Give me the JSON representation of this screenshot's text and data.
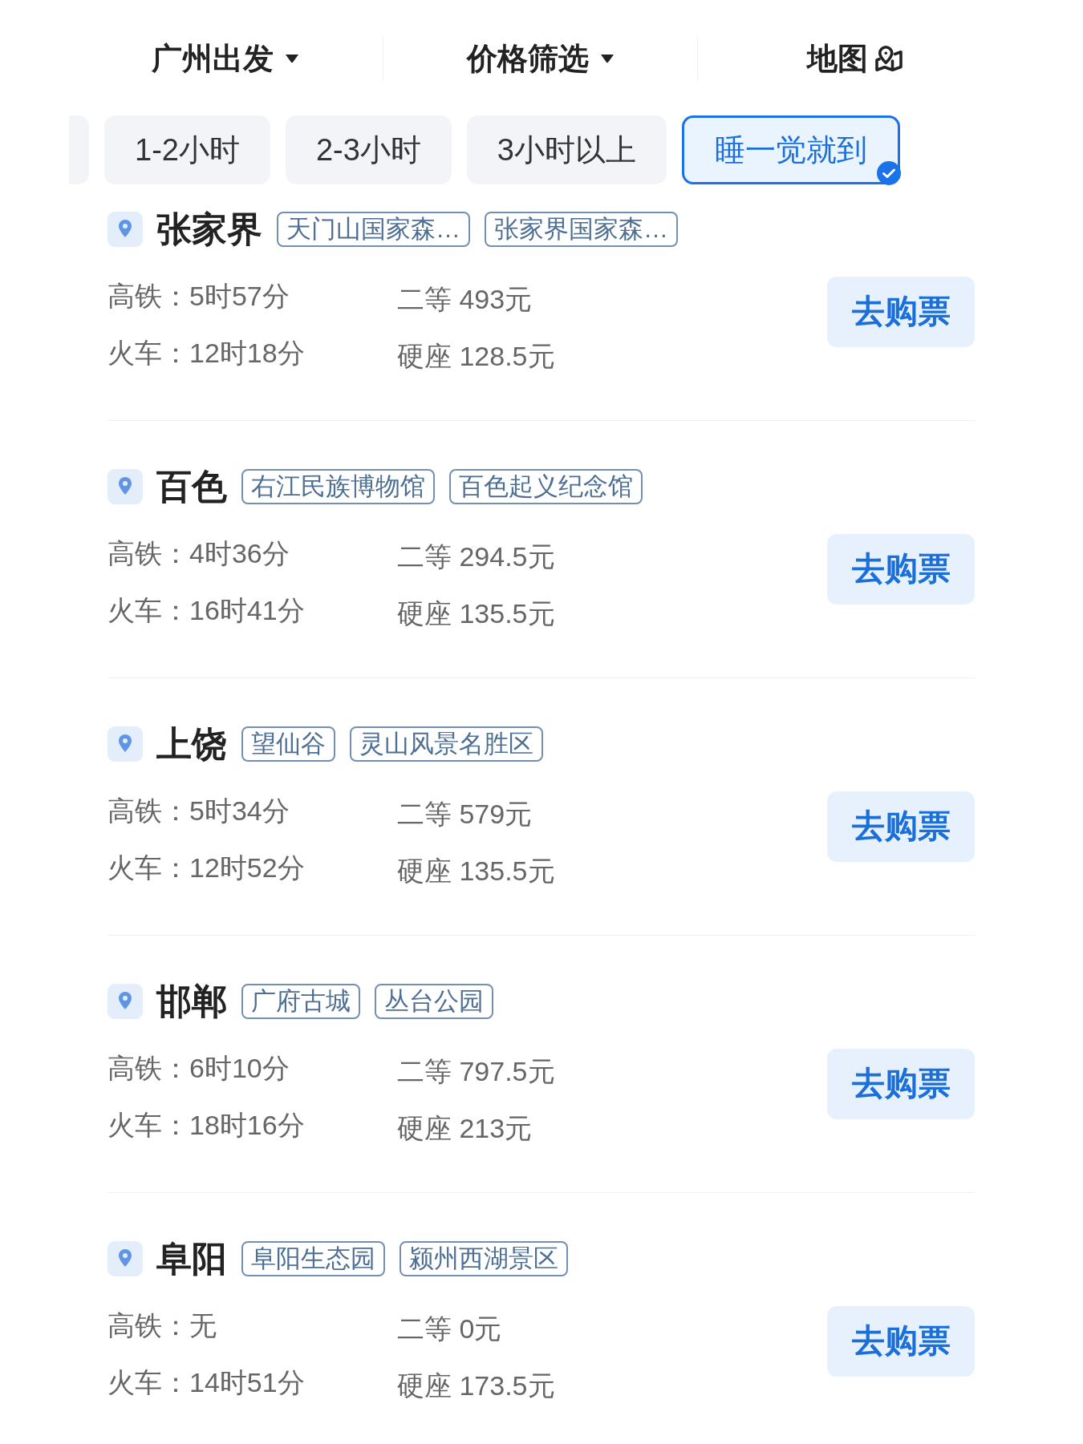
{
  "header": {
    "items": [
      {
        "label": "广州出发",
        "kind": "dropdown"
      },
      {
        "label": "价格筛选",
        "kind": "dropdown"
      },
      {
        "label": "地图",
        "kind": "map"
      }
    ]
  },
  "duration_filters": [
    {
      "kind": "partial",
      "selected": false
    },
    {
      "kind": "chip",
      "label": "1-2小时",
      "selected": false
    },
    {
      "kind": "chip",
      "label": "2-3小时",
      "selected": false
    },
    {
      "kind": "chip",
      "label": "3小时以上",
      "selected": false
    },
    {
      "kind": "chip",
      "label": "睡一觉就到",
      "selected": true
    }
  ],
  "destinations": [
    {
      "city": "张家界",
      "tags": [
        "天门山国家森…",
        "张家界国家森…"
      ],
      "routes": [
        {
          "travel": "高铁：5时57分",
          "fare": "二等 493元"
        },
        {
          "travel": "火车：12时18分",
          "fare": "硬座 128.5元"
        }
      ],
      "button": "去购票"
    },
    {
      "city": "百色",
      "tags": [
        "右江民族博物馆",
        "百色起义纪念馆"
      ],
      "routes": [
        {
          "travel": "高铁：4时36分",
          "fare": "二等 294.5元"
        },
        {
          "travel": "火车：16时41分",
          "fare": "硬座 135.5元"
        }
      ],
      "button": "去购票"
    },
    {
      "city": "上饶",
      "tags": [
        "望仙谷",
        "灵山风景名胜区"
      ],
      "routes": [
        {
          "travel": "高铁：5时34分",
          "fare": "二等 579元"
        },
        {
          "travel": "火车：12时52分",
          "fare": "硬座 135.5元"
        }
      ],
      "button": "去购票"
    },
    {
      "city": "邯郸",
      "tags": [
        "广府古城",
        "丛台公园"
      ],
      "routes": [
        {
          "travel": "高铁：6时10分",
          "fare": "二等 797.5元"
        },
        {
          "travel": "火车：18时16分",
          "fare": "硬座 213元"
        }
      ],
      "button": "去购票"
    },
    {
      "city": "阜阳",
      "tags": [
        "阜阳生态园",
        "颍州西湖景区"
      ],
      "routes": [
        {
          "travel": "高铁：无",
          "fare": "二等 0元"
        },
        {
          "travel": "火车：14时51分",
          "fare": "硬座 173.5元"
        }
      ],
      "button": "去购票"
    }
  ]
}
